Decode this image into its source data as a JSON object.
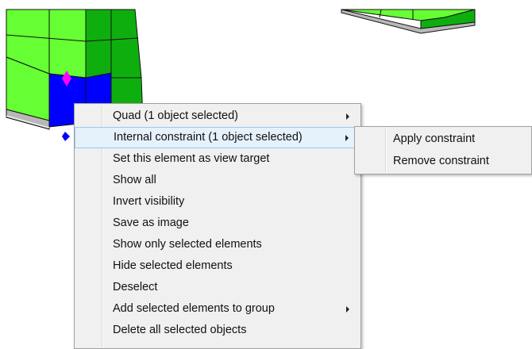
{
  "context_menu": {
    "items": [
      {
        "label": "Quad (1 object selected)",
        "submenu": true
      },
      {
        "label": "Internal constraint (1 object selected)",
        "submenu": true,
        "highlighted": true
      },
      {
        "label": "Set this element as view target",
        "submenu": false
      },
      {
        "label": "Show all",
        "submenu": false
      },
      {
        "label": "Invert visibility",
        "submenu": false
      },
      {
        "label": "Save as image",
        "submenu": false
      },
      {
        "label": "Show only selected elements",
        "submenu": false
      },
      {
        "label": "Hide selected elements",
        "submenu": false
      },
      {
        "label": "Deselect",
        "submenu": false
      },
      {
        "label": "Add selected elements to group",
        "submenu": true
      },
      {
        "label": "Delete all selected objects",
        "submenu": false
      }
    ]
  },
  "submenu": {
    "items": [
      {
        "label": "Apply constraint"
      },
      {
        "label": "Remove constraint"
      }
    ]
  },
  "viewport": {
    "colors": {
      "light_green": "#66ff33",
      "dark_green": "#0fae0f",
      "selected_blue": "#0000ff",
      "marker_magenta": "#ff00ff",
      "base_gray": "#b8b8b8"
    }
  }
}
